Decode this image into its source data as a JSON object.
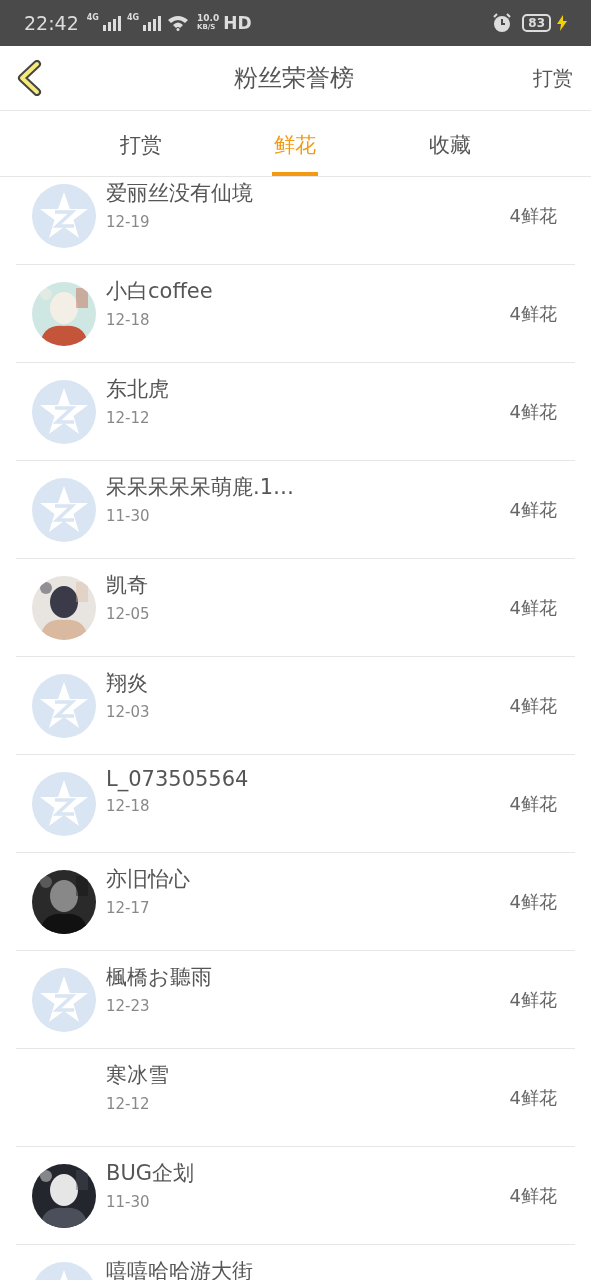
{
  "status_bar": {
    "time": "22:42",
    "network_1": "4G",
    "network_2": "4G",
    "speed_value": "10.0",
    "speed_unit": "KB/S",
    "hd": "HD",
    "battery": "83"
  },
  "header": {
    "title": "粉丝荣誉榜",
    "action": "打赏"
  },
  "tabs": [
    {
      "label": "打赏",
      "selected": false
    },
    {
      "label": "鲜花",
      "selected": true
    },
    {
      "label": "收藏",
      "selected": false
    }
  ],
  "rows": [
    {
      "name": "爱丽丝没有仙境",
      "date": "12-19",
      "amount": "4鲜花",
      "kind": "default"
    },
    {
      "name": "小白coffee",
      "date": "12-18",
      "amount": "4鲜花",
      "kind": "picture"
    },
    {
      "name": "东北虎",
      "date": "12-12",
      "amount": "4鲜花",
      "kind": "default"
    },
    {
      "name": "呆呆呆呆呆萌鹿.1…",
      "date": "11-30",
      "amount": "4鲜花",
      "kind": "default"
    },
    {
      "name": "凯奇",
      "date": "12-05",
      "amount": "4鲜花",
      "kind": "picture"
    },
    {
      "name": "翔炎",
      "date": "12-03",
      "amount": "4鲜花",
      "kind": "default"
    },
    {
      "name": "L_073505564",
      "date": "12-18",
      "amount": "4鲜花",
      "kind": "default"
    },
    {
      "name": "亦旧怡心",
      "date": "12-17",
      "amount": "4鲜花",
      "kind": "picture"
    },
    {
      "name": "楓橋お聽雨",
      "date": "12-23",
      "amount": "4鲜花",
      "kind": "default"
    },
    {
      "name": "寒冰雪",
      "date": "12-12",
      "amount": "4鲜花",
      "kind": "blank"
    },
    {
      "name": "BUG企划",
      "date": "11-30",
      "amount": "4鲜花",
      "kind": "picture"
    },
    {
      "name": "嘻嘻哈哈游大街",
      "kind": "default"
    }
  ]
}
